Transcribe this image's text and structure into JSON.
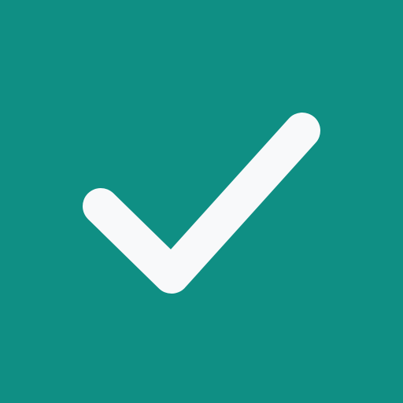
{
  "colors": {
    "background": "#0f8f84",
    "mark": "#f8f9fa"
  },
  "icon": {
    "name": "checkmark-icon"
  }
}
